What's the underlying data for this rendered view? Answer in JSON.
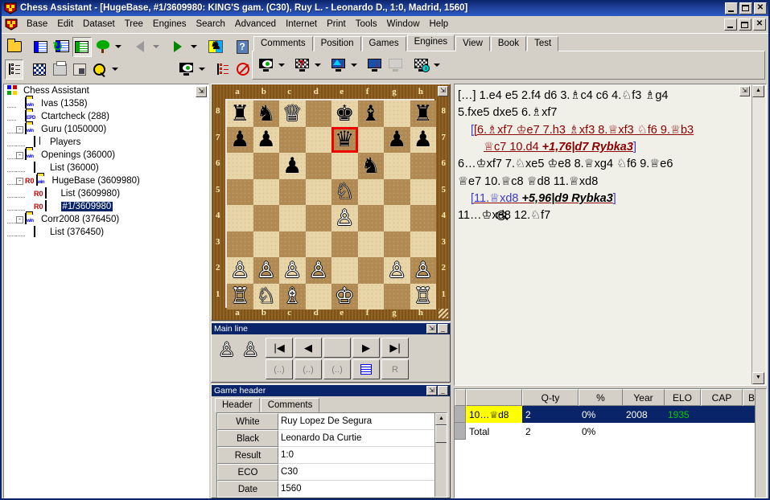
{
  "window": {
    "title": "Chess Assistant - [HugeBase, #1/3609980: KING'S gam. (C30), Ruy L. - Leonardo D., 1:0, Madrid, 1560]",
    "minimize": "_",
    "maximize": "□",
    "close": "✕"
  },
  "menu": {
    "items": [
      "Base",
      "Edit",
      "Dataset",
      "Tree",
      "Engines",
      "Search",
      "Advanced",
      "Internet",
      "Print",
      "Tools",
      "Window",
      "Help"
    ]
  },
  "toolbar_tabs": {
    "items": [
      "Comments",
      "Position",
      "Games",
      "Engines",
      "View",
      "Book",
      "Test"
    ],
    "active": "Engines"
  },
  "tree": {
    "items": [
      {
        "label": "Chess Assistant",
        "depth": 0,
        "expander": "",
        "icon": "app-root-icon"
      },
      {
        "label": "Ivas (1358)",
        "depth": 1,
        "expander": "",
        "icon": "folder-win-icon"
      },
      {
        "label": "Ctartcheck (288)",
        "depth": 1,
        "expander": "",
        "icon": "folder-epd-icon"
      },
      {
        "label": "Guru (1050000)",
        "depth": 1,
        "expander": "-",
        "icon": "folder-win-icon"
      },
      {
        "label": "Players",
        "depth": 2,
        "expander": "",
        "icon": "book-icon"
      },
      {
        "label": "Openings (36000)",
        "depth": 1,
        "expander": "-",
        "icon": "folder-win-icon"
      },
      {
        "label": "List (36000)",
        "depth": 2,
        "expander": "",
        "icon": "list-icon"
      },
      {
        "label": "HugeBase (3609980)",
        "depth": 1,
        "expander": "-",
        "icon": "folder-win-icon",
        "badge": "R0"
      },
      {
        "label": "List (3609980)",
        "depth": 2,
        "expander": "",
        "icon": "list-icon",
        "badge": "R0"
      },
      {
        "label": "#1/3609980",
        "depth": 2,
        "expander": "",
        "icon": "list-dark-icon",
        "badge": "R0",
        "selected": true
      },
      {
        "label": "Corr2008 (376450)",
        "depth": 1,
        "expander": "-",
        "icon": "folder-win-icon"
      },
      {
        "label": "List (376450)",
        "depth": 2,
        "expander": "",
        "icon": "list-icon"
      }
    ]
  },
  "board": {
    "files": [
      "a",
      "b",
      "c",
      "d",
      "e",
      "f",
      "g",
      "h"
    ],
    "ranks": [
      "8",
      "7",
      "6",
      "5",
      "4",
      "3",
      "2",
      "1"
    ],
    "highlight_square": "e7",
    "position": [
      [
        "r",
        "n",
        "Q",
        "",
        "k",
        "b",
        "",
        "r"
      ],
      [
        "p",
        "p",
        "",
        "",
        "q",
        "",
        "p",
        "p"
      ],
      [
        "",
        "",
        "p",
        "",
        "",
        "n",
        "",
        ""
      ],
      [
        "",
        "",
        "",
        "",
        "N",
        "",
        "",
        ""
      ],
      [
        "",
        "",
        "",
        "",
        "P",
        "",
        "",
        ""
      ],
      [
        "",
        "",
        "",
        "",
        "",
        "",
        "",
        ""
      ],
      [
        "P",
        "P",
        "P",
        "P",
        "",
        "",
        "P",
        "P"
      ],
      [
        "R",
        "N",
        "B",
        "",
        "K",
        "",
        "",
        "R"
      ]
    ]
  },
  "mainline": {
    "title": "Main line",
    "nav": [
      "|◀",
      "◀",
      "",
      "▶",
      "▶|"
    ],
    "nav2": [
      "(..)",
      "(..)",
      "(..)",
      "list",
      "R"
    ]
  },
  "game_header": {
    "title": "Game header",
    "tabs": [
      "Header",
      "Comments"
    ],
    "active_tab": "Header",
    "fields": [
      {
        "key": "White",
        "value": "Ruy Lopez De Segura"
      },
      {
        "key": "Black",
        "value": "Leonardo Da Curtie"
      },
      {
        "key": "Result",
        "value": "1:0"
      },
      {
        "key": "ECO",
        "value": "C30"
      },
      {
        "key": "Date",
        "value": "1560"
      }
    ]
  },
  "notation": {
    "prefix": "[…]",
    "line1": "1.e4 e5 2.f4 d6 3.♗c4 c6 4.♘f3 ♗g4",
    "line2": "5.fxe5 dxe5 6.♗xf7",
    "variation1": "[6.♗xf7 ♔e7 7.h3 ♗xf3 8.♕xf3 ♘f6 9.♕b3 ♕c7 10.d4 +1,76|d7 Rybka3]",
    "variation1_a": "[6.♗xf7 ♔e7 7.h3 ♗xf3 8.♕xf3 ♘f6 9.♕b3",
    "variation1_b": "♕c7 10.d4 ",
    "variation1_eval": "+1,76|d7 Rybka3",
    "line3": "6…♔xf7 7.♘xe5 ♔e8 8.♕xg4 ♘f6 9.♕e6",
    "line4": "♕e7 10.♕c8 ♕d8 11.♕xd8",
    "variation2_open": "[11.♕xd8 ",
    "variation2_eval": "+5,96|d9 Rybka3",
    "variation2_close": "]",
    "line5": "11…♔xd8 12.♘f7"
  },
  "stats_table": {
    "columns": [
      "",
      "Q-ty",
      "%",
      "Year",
      "ELO",
      "CAP",
      "B("
    ],
    "rows": [
      {
        "move": "10…♕d8",
        "qty": "2",
        "pct": "0%",
        "year": "2008",
        "elo": "1935",
        "cap": "",
        "bg": "",
        "selected": true,
        "highlight_move": true
      },
      {
        "move": "Total",
        "qty": "2",
        "pct": "0%",
        "year": "",
        "elo": "",
        "cap": "",
        "bg": ""
      }
    ]
  },
  "colors": {
    "titlebar": "#0a246a",
    "face": "#d4d0c8",
    "selection": "#0a246a",
    "highlight_yellow": "#ffff00",
    "variation_red": "#8b0000",
    "elo_green": "#00cc00",
    "board_light": "#e8d5a8",
    "board_dark": "#b08a52"
  }
}
